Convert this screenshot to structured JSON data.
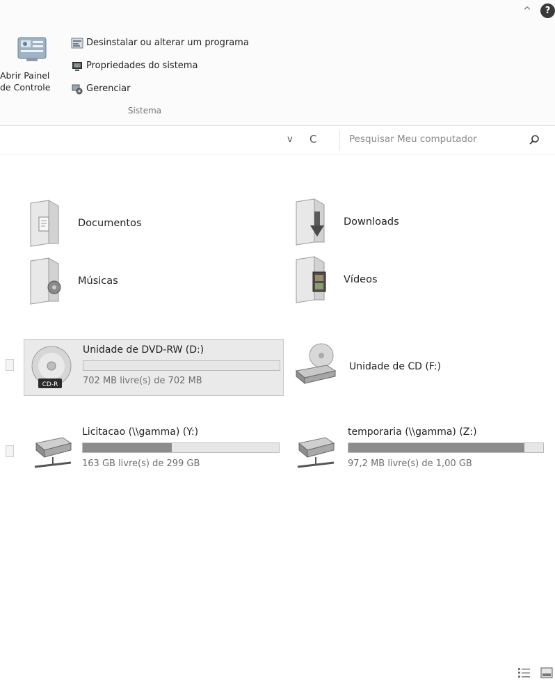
{
  "ribbon": {
    "open_control_panel": "Abrir Painel\nde Controle",
    "uninstall": "Desinstalar ou alterar um programa",
    "system_properties": "Propriedades do sistema",
    "manage": "Gerenciar",
    "group_label": "Sistema",
    "collapse_glyph": "^",
    "help_glyph": "?"
  },
  "address_bar": {
    "dropdown_glyph": "v",
    "refresh_glyph": "C",
    "search_placeholder": "Pesquisar Meu computador"
  },
  "folders": [
    {
      "name": "Documentos",
      "icon": "documents-folder-icon"
    },
    {
      "name": "Downloads",
      "icon": "downloads-folder-icon"
    },
    {
      "name": "Músicas",
      "icon": "music-folder-icon"
    },
    {
      "name": "Vídeos",
      "icon": "videos-folder-icon"
    }
  ],
  "drives": [
    {
      "name": "Unidade de DVD-RW (D:)",
      "free_text": "702 MB livre(s) de 702 MB",
      "used_fraction": 0.0,
      "badge": "CD-R",
      "selected": true
    },
    {
      "name": "Unidade de CD (F:)",
      "selected": false
    },
    {
      "name": "Licitacao (\\\\gamma) (Y:)",
      "free_text": "163 GB livre(s) de 299 GB",
      "used_fraction": 0.455
    },
    {
      "name": "temporaria (\\\\gamma) (Z:)",
      "free_text": "97,2 MB livre(s) de 1,00 GB",
      "used_fraction": 0.905
    }
  ],
  "colors": {
    "bar_fill": "#8c8c8c",
    "bar_bg": "#e6e6e6",
    "selection_bg": "#eaeaea"
  }
}
